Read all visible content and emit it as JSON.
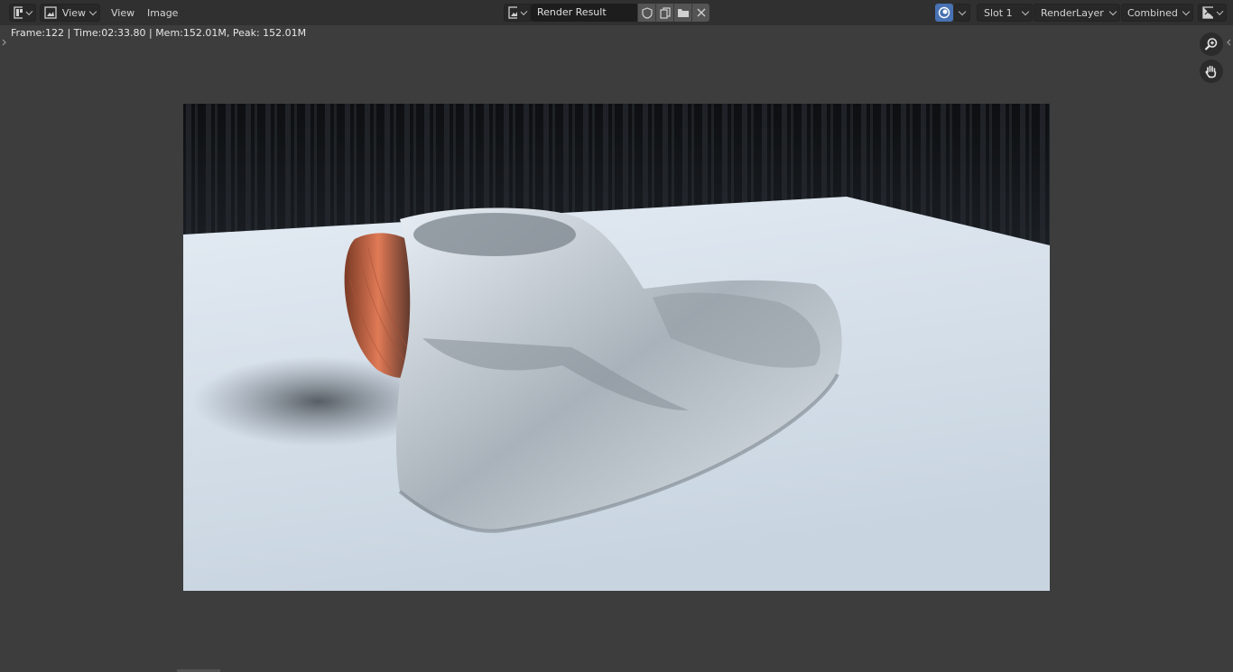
{
  "header": {
    "view_menu_1": "View",
    "view_menu_2": "View",
    "image_menu": "Image",
    "image_name": "Render Result",
    "slot": "Slot 1",
    "render_layer": "RenderLayer",
    "pass": "Combined"
  },
  "status": {
    "text": "Frame:122 | Time:02:33.80 | Mem:152.01M, Peak: 152.01M"
  },
  "icons": {
    "editor_type": "image-editor-icon",
    "mode": "image-icon",
    "browse": "image-browse-icon",
    "fake_user": "shield-icon",
    "new_image": "duplicate-icon",
    "open_image": "folder-icon",
    "unlink": "close-icon",
    "render_slot": "render-icon",
    "display_channels": "display-channels-icon",
    "zoom": "zoom-icon",
    "pan": "hand-icon"
  },
  "colors": {
    "accent_blue": "#4772b3",
    "header_bg": "#303030",
    "area_bg": "#3d3d3d"
  }
}
